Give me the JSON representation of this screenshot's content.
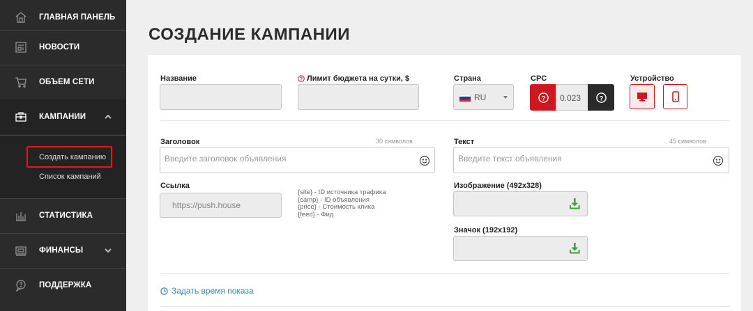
{
  "sidebar": {
    "items": [
      {
        "label": "ГЛАВНАЯ ПАНЕЛЬ",
        "icon": "home-icon"
      },
      {
        "label": "НОВОСТИ",
        "icon": "news-icon"
      },
      {
        "label": "ОБЪЕМ СЕТИ",
        "icon": "cart-icon"
      },
      {
        "label": "КАМПАНИИ",
        "icon": "briefcase-icon"
      },
      {
        "label": "СТАТИСТИКА",
        "icon": "bar-chart-icon"
      },
      {
        "label": "ФИНАНСЫ",
        "icon": "wallet-icon"
      },
      {
        "label": "ПОДДЕРЖКА",
        "icon": "support-chat-icon"
      }
    ],
    "submenu": [
      "Создать кампанию",
      "Список кампаний"
    ]
  },
  "page": {
    "title": "СОЗДАНИЕ КАМПАНИИ"
  },
  "form": {
    "name_label": "Название",
    "budget_label": "Лимит бюджета на сутки, $",
    "country_label": "Страна",
    "country_value": "RU",
    "cpc_label": "CPC",
    "cpc_value": "0.023",
    "device_label": "Устройство",
    "headline_label": "Заголовок",
    "headline_hint": "30 символов",
    "headline_placeholder": "Введите заголовок объявления",
    "text_label": "Текст",
    "text_hint": "45 символов",
    "text_placeholder": "Введите текст объявления",
    "link_label": "Ссылка",
    "link_value": "https://push.house",
    "macros": [
      "{site} - ID источника трафика",
      "{camp} - ID объявления",
      "{price} - Стоимость клика",
      "{feed} - Фид"
    ],
    "image_label": "Изображение (492x328)",
    "icon_label": "Значок (192x192)",
    "schedule_link": "Задать время показа"
  },
  "colors": {
    "accent": "#d0171f",
    "sidebar": "#2b2b2b",
    "upload": "#3aa53a",
    "link": "#2e8bd4"
  }
}
